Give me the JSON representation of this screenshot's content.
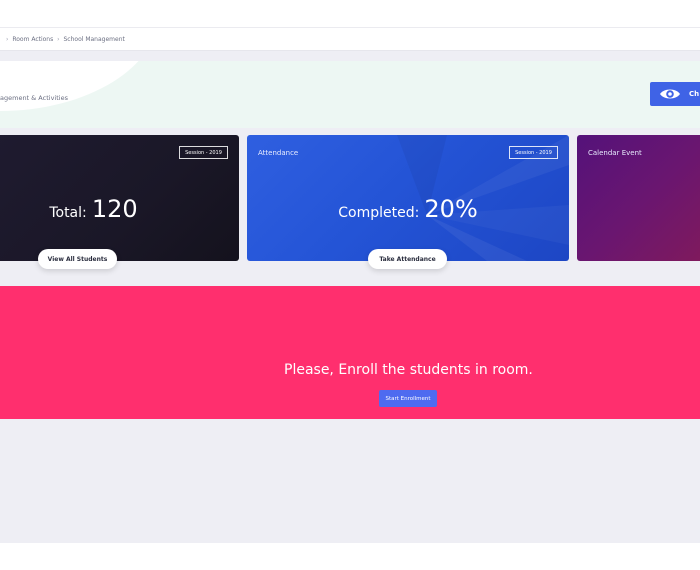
{
  "breadcrumb": {
    "items": [
      "Room Actions",
      "School Management"
    ],
    "separator": "›"
  },
  "hero": {
    "subtitle": "agement & Activities",
    "button_label": "Ch"
  },
  "cards": {
    "students": {
      "session_badge": "Session - 2019",
      "stat_label": "Total:",
      "stat_value": "120",
      "button_label": "View All Students"
    },
    "attendance": {
      "title": "Attendance",
      "session_badge": "Session - 2019",
      "stat_label": "Completed:",
      "stat_value": "20%",
      "button_label": "Take Attendance"
    },
    "calendar": {
      "title": "Calendar Event"
    }
  },
  "enroll": {
    "message": "Please, Enroll the students in room.",
    "button_label": "Start Enrollment"
  },
  "colors": {
    "accent": "#3f63e6",
    "enroll_background": "#ff2f6e",
    "attendance_card": "#2454d6",
    "students_card": "#1a1727",
    "calendar_card": "#6a1670"
  },
  "icons": {
    "hero_button": "eye-icon"
  }
}
